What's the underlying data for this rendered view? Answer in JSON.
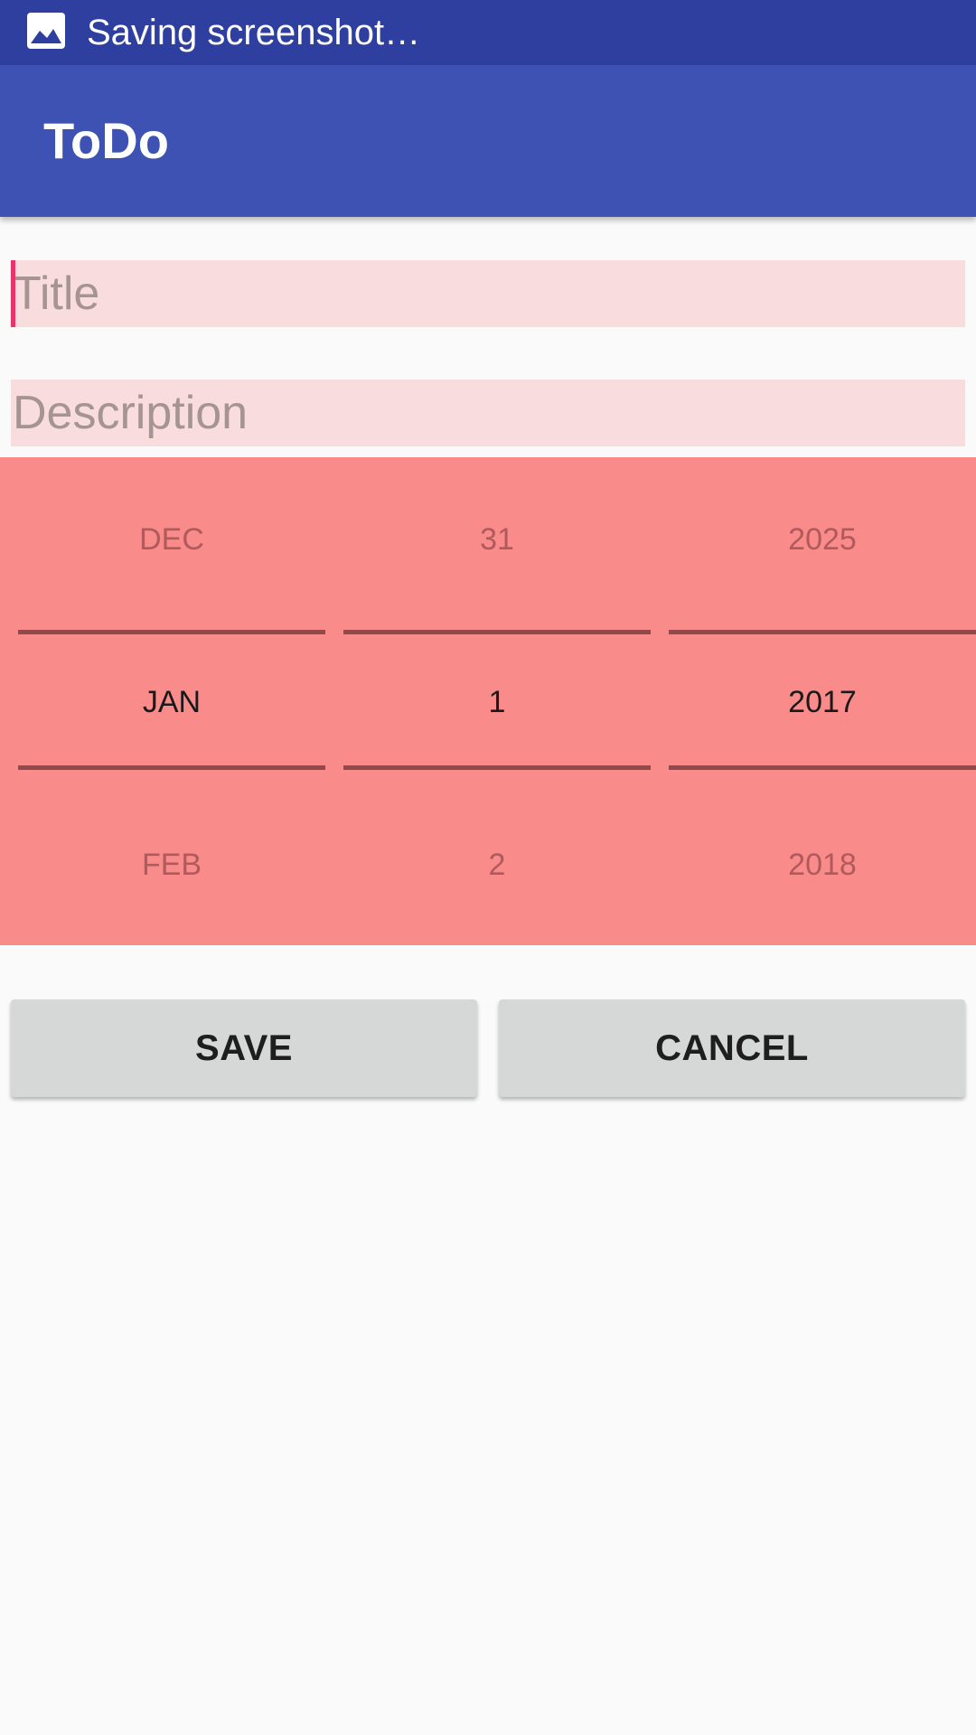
{
  "status_bar": {
    "icon": "image-icon",
    "text": "Saving screenshot…",
    "color": "#2e3f9f"
  },
  "app_bar": {
    "title": "ToDo",
    "color": "#3d52b3"
  },
  "form": {
    "title_placeholder": "Title",
    "title_value": "",
    "description_placeholder": "Description",
    "description_value": ""
  },
  "date_picker": {
    "background": "#f98b8b",
    "month": {
      "prev": "DEC",
      "selected": "JAN",
      "next": "FEB"
    },
    "day": {
      "prev": "31",
      "selected": "1",
      "next": "2"
    },
    "year": {
      "prev": "2025",
      "selected": "2017",
      "next": "2018"
    }
  },
  "actions": {
    "save_label": "SAVE",
    "cancel_label": "CANCEL"
  }
}
